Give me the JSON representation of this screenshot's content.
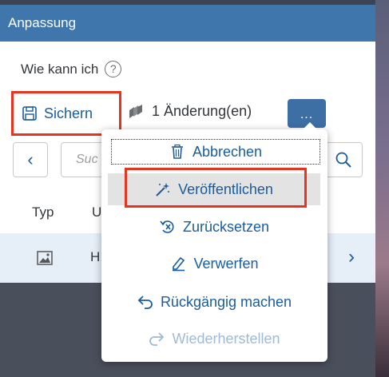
{
  "panel": {
    "title": "Anpassung",
    "howto_label": "Wie kann ich",
    "help_icon": "?"
  },
  "toolbar": {
    "save_label": "Sichern",
    "changes_label": "1 Änderung(en)",
    "more_label": "..."
  },
  "search": {
    "placeholder": "Suc",
    "back_symbol": "‹"
  },
  "table": {
    "columns": [
      "Typ",
      "U"
    ],
    "rows": [
      {
        "type_icon": "image-icon",
        "name": "H"
      }
    ],
    "row_chevron": "›"
  },
  "menu": {
    "items": [
      {
        "label": "Abbrechen",
        "icon": "trash-icon",
        "state": "focused"
      },
      {
        "label": "Veröffentlichen",
        "icon": "magic-wand-icon",
        "state": "selected"
      },
      {
        "label": "Zurücksetzen",
        "icon": "reset-icon",
        "state": "normal"
      },
      {
        "label": "Verwerfen",
        "icon": "eraser-icon",
        "state": "normal"
      },
      {
        "label": "Rückgängig machen",
        "icon": "undo-icon",
        "state": "normal"
      },
      {
        "label": "Wiederherstellen",
        "icon": "redo-icon",
        "state": "disabled"
      }
    ]
  },
  "colors": {
    "header": "#3f77ad",
    "accent": "#1a5c9e",
    "highlight": "#e8341f",
    "selected": "#e3e3e3",
    "disabled": "#9fbad4"
  }
}
